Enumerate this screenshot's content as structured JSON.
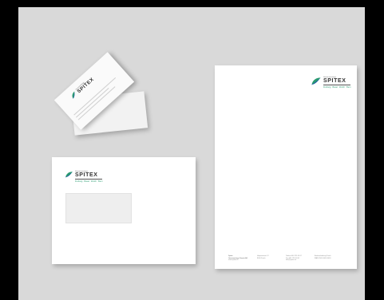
{
  "brand": {
    "name": "SPITEX",
    "tagline_top": "Gemeinnützige",
    "tagline_bottom": "Freiburg · Basel · Zürich · Bern",
    "colors": {
      "green": "#2a9a70",
      "blue": "#1e5aa8",
      "text": "#333333"
    }
  },
  "letter_footer": [
    [
      "Spitex",
      "Gemeinnützige Dienste AG",
      "www.spitex.ch"
    ],
    [
      "Hauptstrasse 12",
      "8000 Zürich"
    ],
    [
      "Telefon 044 123 45 67",
      "Fax 044 123 45 68",
      "info@spitex.ch"
    ],
    [
      "Bankverbindung Zürich",
      "IBAN CH00 0000 0000"
    ]
  ]
}
